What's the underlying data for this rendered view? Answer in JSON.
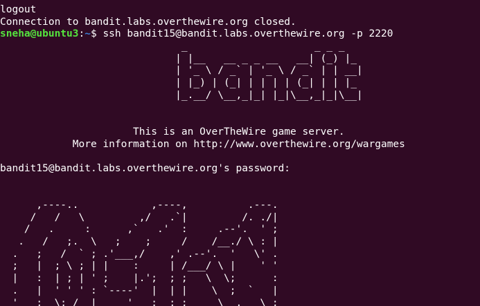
{
  "history": [
    "logout",
    "Connection to bandit.labs.overthewire.org closed."
  ],
  "prompt": {
    "user_host": "sneha@ubuntu3",
    "separator": ":",
    "path": "~",
    "symbol": "$ ",
    "command": "ssh bandit15@bandit.labs.overthewire.org -p 2220"
  },
  "banner": [
    "                              _                     _ _ _   ",
    "                             | |__   __ _ _ __   __| (_) |_ ",
    "                             | '_ \\ / _` | '_ \\ / _` | | __|",
    "                             | |_) | (_| | | | | (_| | | |_ ",
    "                             |_.__/ \\__,_|_| |_|\\__,_|_|\\__|",
    "",
    "",
    "                      This is an OverTheWire game server.",
    "            More information on http://www.overthewire.org/wargames",
    "",
    "bandit15@bandit.labs.overthewire.org's password:",
    "",
    "",
    "      ,----..            ,----,          .---.",
    "     /   /   \\         ,/   .`|         /. ./|",
    "    /   .     :      ,`   .'  :     .--'.  ' ;",
    "   .   /   ;.  \\   ;    ;     /    /__./ \\ : |",
    "  .   ;   /  ` ; .'___,/    ,' .--'.  '   \\' .",
    "  ;   |  ; \\ ; | |    :     | /___/ \\ |    ' '",
    "  |   :  | ; | ' ;    |.';  ; ;   \\  \\;      :",
    "  .   |  ' ' ' : `----'  |  | |    \\  ;  `   |",
    "  '   ;  \\; /  |     '   :  ; ;     \\  .   \\ ;"
  ]
}
